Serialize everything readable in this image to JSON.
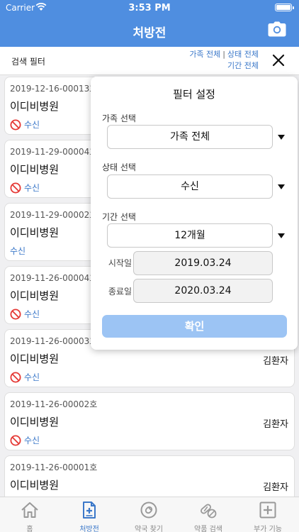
{
  "status_bar": {
    "carrier": "Carrier",
    "time": "3:53 PM"
  },
  "nav": {
    "title": "처방전",
    "camera_icon": "camera-icon"
  },
  "filter_bar": {
    "label": "검색 필터",
    "family_summary": "가족 전체",
    "status_summary": "상태 전체",
    "period_summary": "기간 전체",
    "close_icon": "close-icon"
  },
  "prescriptions": [
    {
      "no": "2019-12-16-00013호",
      "hospital": "이디비병원",
      "patient": "",
      "status": "수신",
      "no_icon": true
    },
    {
      "no": "2019-11-29-00004호",
      "hospital": "이디비병원",
      "patient": "",
      "status": "수신",
      "no_icon": true
    },
    {
      "no": "2019-11-29-00002호",
      "hospital": "이디비병원",
      "patient": "",
      "status": "수신",
      "no_icon": false
    },
    {
      "no": "2019-11-26-00004호",
      "hospital": "이디비병원",
      "patient": "",
      "status": "수신",
      "no_icon": true
    },
    {
      "no": "2019-11-26-00003호",
      "hospital": "이디비병원",
      "patient": "김환자",
      "status": "수신",
      "no_icon": true
    },
    {
      "no": "2019-11-26-00002호",
      "hospital": "이디비병원",
      "patient": "김환자",
      "status": "수신",
      "no_icon": true
    },
    {
      "no": "2019-11-26-00001호",
      "hospital": "이디비병원",
      "patient": "김환자",
      "status": "",
      "no_icon": false
    }
  ],
  "filter_panel": {
    "title": "필터 설정",
    "family_label": "가족 선택",
    "family_value": "가족 전체",
    "status_label": "상태 선택",
    "status_value": "수신",
    "period_label": "기간 선택",
    "period_value": "12개월",
    "start_label": "시작일",
    "start_value": "2019.03.24",
    "end_label": "종료일",
    "end_value": "2020.03.24",
    "confirm_label": "확인"
  },
  "tabs": [
    {
      "label": "홈",
      "icon": "home-icon",
      "active": false
    },
    {
      "label": "처방전",
      "icon": "prescription-icon",
      "active": true
    },
    {
      "label": "약국 찾기",
      "icon": "pharmacy-search-icon",
      "active": false
    },
    {
      "label": "약품 검색",
      "icon": "pill-search-icon",
      "active": false
    },
    {
      "label": "부가 기능",
      "icon": "plus-box-icon",
      "active": false
    }
  ],
  "colors": {
    "primary": "#4f8ee0",
    "link": "#3b78c9",
    "confirm_disabled": "#9cc4f4",
    "no_icon": "#e53935"
  }
}
